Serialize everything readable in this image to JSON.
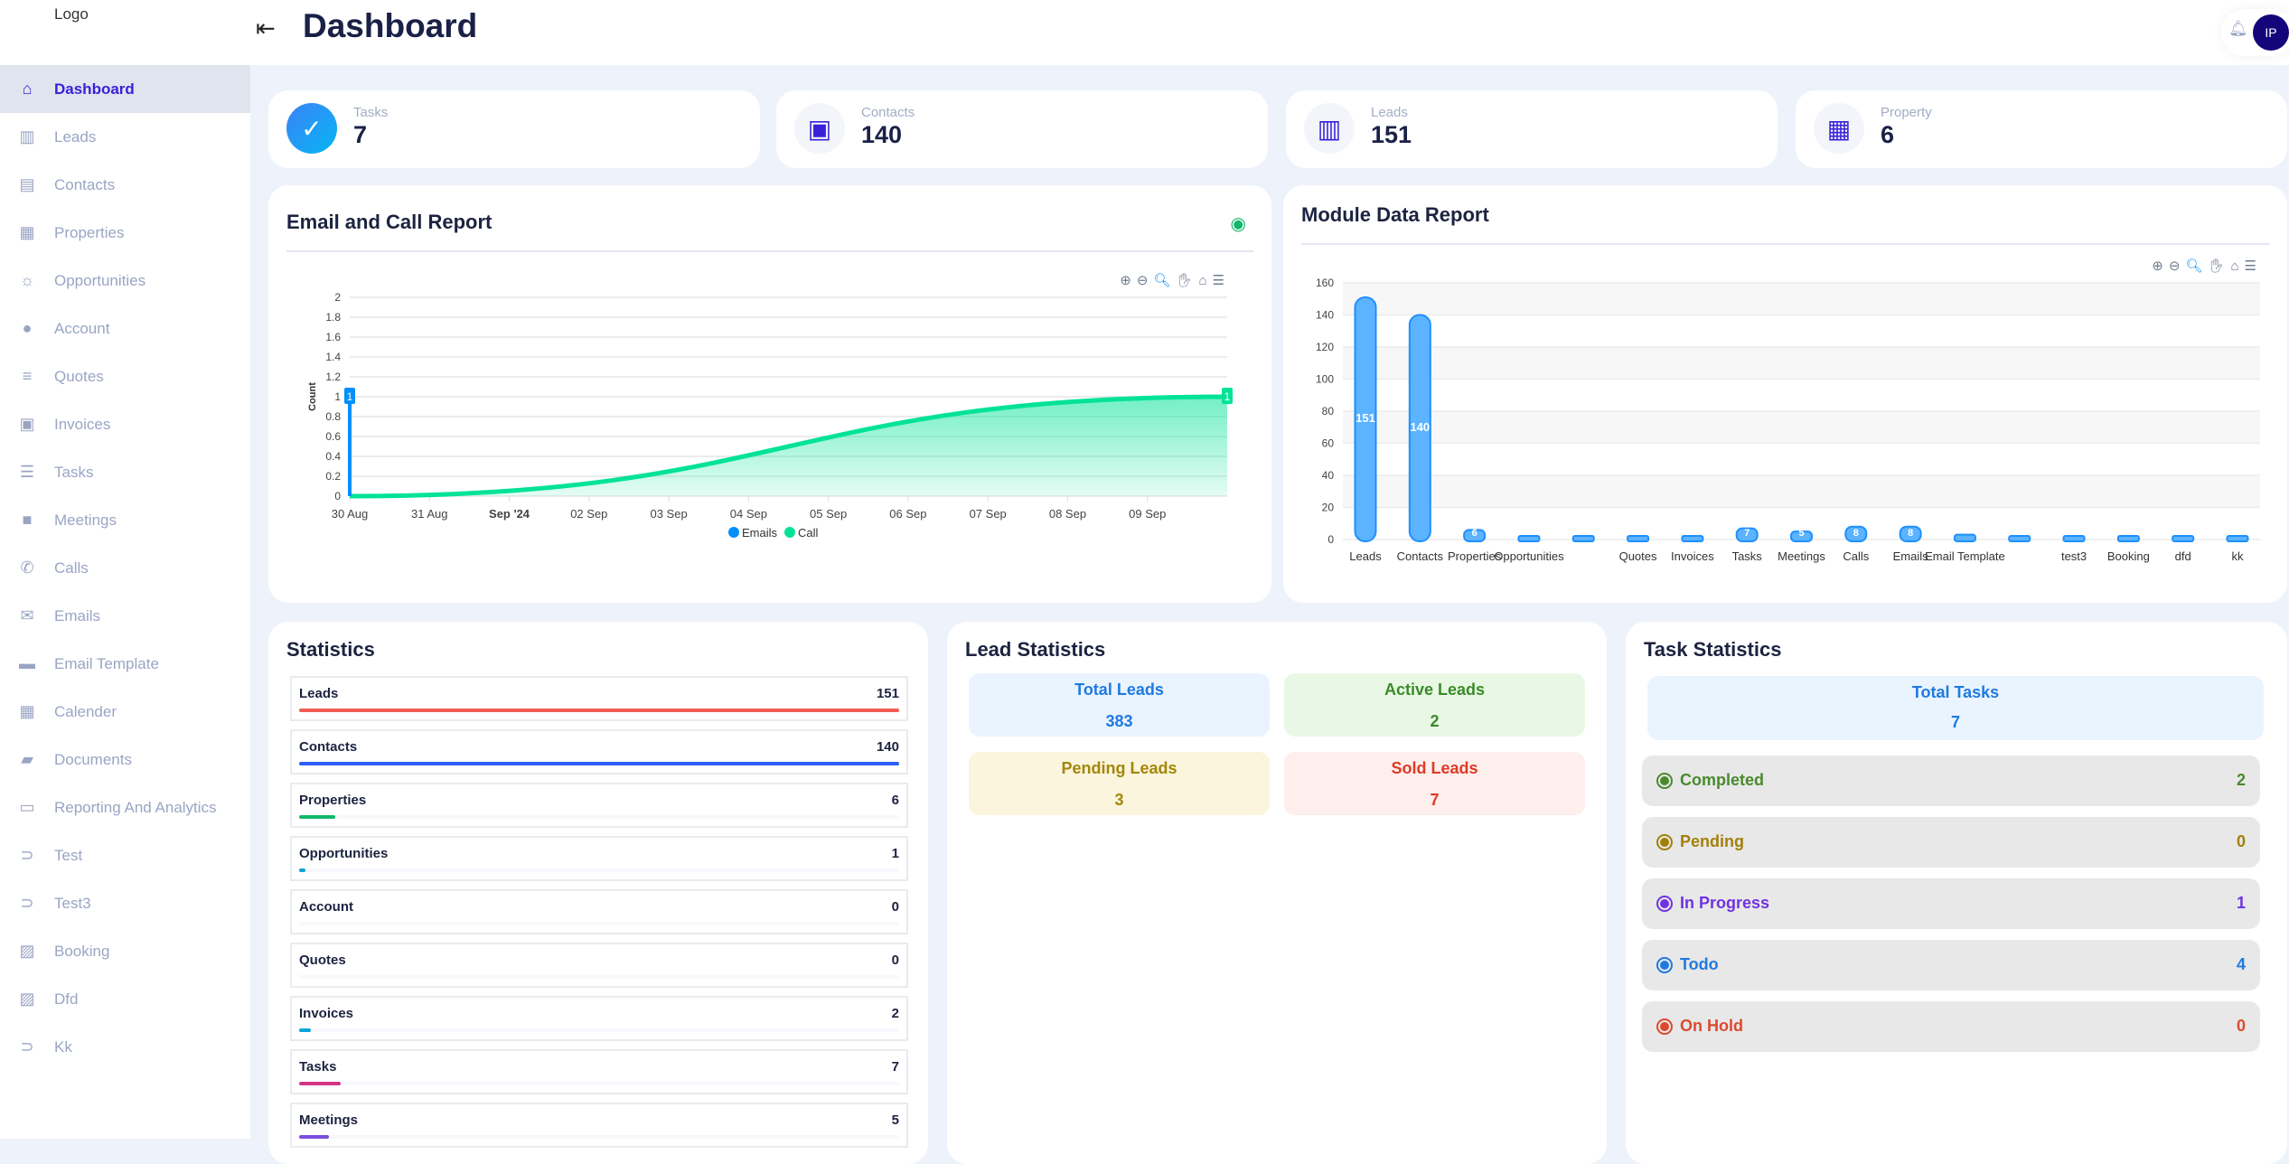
{
  "sidebar": {
    "logo_alt": "Logo",
    "items": [
      {
        "label": "Dashboard",
        "icon": "home-icon",
        "active": true
      },
      {
        "label": "Leads",
        "icon": "bar-chart-icon"
      },
      {
        "label": "Contacts",
        "icon": "contact-card-icon"
      },
      {
        "label": "Properties",
        "icon": "building-icon"
      },
      {
        "label": "Opportunities",
        "icon": "lightbulb-icon"
      },
      {
        "label": "Account",
        "icon": "user-circle-icon"
      },
      {
        "label": "Quotes",
        "icon": "quote-icon"
      },
      {
        "label": "Invoices",
        "icon": "invoice-icon"
      },
      {
        "label": "Tasks",
        "icon": "checklist-icon"
      },
      {
        "label": "Meetings",
        "icon": "video-icon"
      },
      {
        "label": "Calls",
        "icon": "phone-icon"
      },
      {
        "label": "Emails",
        "icon": "envelope-icon"
      },
      {
        "label": "Email Template",
        "icon": "template-icon"
      },
      {
        "label": "Calender",
        "icon": "calendar-icon"
      },
      {
        "label": "Documents",
        "icon": "folder-icon"
      },
      {
        "label": "Reporting And Analytics",
        "icon": "report-icon"
      },
      {
        "label": "Test",
        "icon": "chevron-circle-icon"
      },
      {
        "label": "Test3",
        "icon": "chevron-circle-icon"
      },
      {
        "label": "Booking",
        "icon": "broken-image-icon"
      },
      {
        "label": "Dfd",
        "icon": "broken-image-icon"
      },
      {
        "label": "Kk",
        "icon": "chevron-circle-icon"
      }
    ]
  },
  "header": {
    "title": "Dashboard",
    "avatar_initials": "IP"
  },
  "stat_cards": [
    {
      "label": "Tasks",
      "value": "7",
      "icon": "task-add-icon"
    },
    {
      "label": "Contacts",
      "value": "140",
      "icon": "contact-book-icon"
    },
    {
      "label": "Leads",
      "value": "151",
      "icon": "bar-chart-icon"
    },
    {
      "label": "Property",
      "value": "6",
      "icon": "building-icon"
    }
  ],
  "email_call_report": {
    "title": "Email and Call Report"
  },
  "module_report": {
    "title": "Module Data Report"
  },
  "chart_data": [
    {
      "type": "area",
      "ylabel": "Count",
      "ylim": [
        0,
        2
      ],
      "yticks": [
        0,
        0.2,
        0.4,
        0.6,
        0.8,
        1,
        1.2,
        1.4,
        1.6,
        1.8,
        2
      ],
      "xticks": [
        "30 Aug",
        "31 Aug",
        "Sep '24",
        "02 Sep",
        "03 Sep",
        "04 Sep",
        "05 Sep",
        "06 Sep",
        "07 Sep",
        "08 Sep",
        "09 Sep"
      ],
      "grid": true,
      "legend": "bottom",
      "series": [
        {
          "name": "Emails",
          "color": "#008ffb",
          "points": [
            {
              "x": "2024-08-30",
              "y": 1
            }
          ]
        },
        {
          "name": "Call",
          "color": "#00e396",
          "points": [
            {
              "x": "2024-08-30",
              "y": 0
            },
            {
              "x": "2024-09-10",
              "y": 1
            }
          ]
        }
      ],
      "data_labels": [
        "1",
        "1"
      ]
    },
    {
      "type": "bar",
      "ylim": [
        0,
        160
      ],
      "yticks": [
        0,
        20,
        40,
        60,
        80,
        100,
        120,
        140,
        160
      ],
      "grid": true,
      "color": "#1e90ff",
      "categories": [
        "Leads",
        "Contacts",
        "Properties",
        "Opportunities",
        "",
        "Quotes",
        "Invoices",
        "Tasks",
        "Meetings",
        "Calls",
        "Emails",
        "Email Template",
        "",
        "test3",
        "Booking",
        "dfd",
        "kk"
      ],
      "values": [
        151,
        140,
        6,
        1,
        0,
        0,
        2,
        7,
        5,
        8,
        8,
        3,
        1,
        0,
        1,
        1,
        0
      ]
    }
  ],
  "statistics": {
    "title": "Statistics",
    "items": [
      {
        "label": "Leads",
        "value": 151,
        "color": "#f25c54"
      },
      {
        "label": "Contacts",
        "value": 140,
        "color": "#2f5cf5"
      },
      {
        "label": "Properties",
        "value": 6,
        "color": "#12b76a"
      },
      {
        "label": "Opportunities",
        "value": 1,
        "color": "#0ba5d8"
      },
      {
        "label": "Account",
        "value": 0,
        "color": "#0ba5d8"
      },
      {
        "label": "Quotes",
        "value": 0,
        "color": "#0ba5d8"
      },
      {
        "label": "Invoices",
        "value": 2,
        "color": "#0ba5d8"
      },
      {
        "label": "Tasks",
        "value": 7,
        "color": "#d63384"
      },
      {
        "label": "Meetings",
        "value": 5,
        "color": "#7c4ddf"
      }
    ]
  },
  "lead_statistics": {
    "title": "Lead Statistics",
    "boxes": [
      {
        "label": "Total Leads",
        "value": "383",
        "color": "#1f7ae0",
        "bg": "#eaf4fe"
      },
      {
        "label": "Active Leads",
        "value": "2",
        "color": "#3b8a2a",
        "bg": "#e8f8e4"
      },
      {
        "label": "Pending Leads",
        "value": "3",
        "color": "#a3860a",
        "bg": "#faf5dc"
      },
      {
        "label": "Sold Leads",
        "value": "7",
        "color": "#dc3b26",
        "bg": "#feeeec"
      }
    ],
    "radial": {
      "total_label": "Total",
      "total_value": "383",
      "series": [
        {
          "name": "Active",
          "value": 2,
          "color": "#2bbf8a"
        },
        {
          "name": "Pending",
          "value": 3,
          "color": "#f1c94c"
        },
        {
          "name": "Sold",
          "value": 7,
          "color": "#f25c5c"
        }
      ]
    }
  },
  "task_statistics": {
    "title": "Task Statistics",
    "total_label": "Total Tasks",
    "total_value": "7",
    "items": [
      {
        "label": "Completed",
        "value": "2",
        "color": "#4a8a2e"
      },
      {
        "label": "Pending",
        "value": "0",
        "color": "#a3800a"
      },
      {
        "label": "In Progress",
        "value": "1",
        "color": "#7033e0"
      },
      {
        "label": "Todo",
        "value": "4",
        "color": "#1f7ae0"
      },
      {
        "label": "On Hold",
        "value": "0",
        "color": "#dc4a2e"
      }
    ]
  }
}
